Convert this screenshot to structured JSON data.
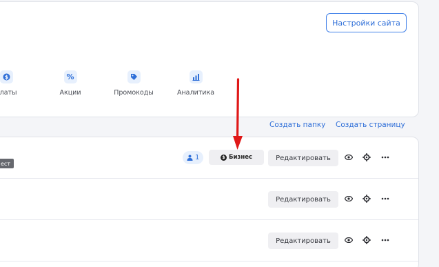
{
  "header": {
    "settings_label": "Настройки сайта"
  },
  "nav": {
    "items": [
      {
        "label": "платы",
        "icon": "dollar-icon",
        "glyph": "$"
      },
      {
        "label": "Акции",
        "icon": "percent-icon",
        "glyph": "%"
      },
      {
        "label": "Промокоды",
        "icon": "tag-icon",
        "glyph": ""
      },
      {
        "label": "Аналитика",
        "icon": "chart-icon",
        "glyph": ""
      }
    ]
  },
  "actions": {
    "create_folder": "Создать папку",
    "create_page": "Создать страницу"
  },
  "rows": [
    {
      "badge": "ест",
      "users_count": "1",
      "plan": "Бизнес",
      "edit_label": "Редактировать"
    },
    {
      "edit_label": "Редактировать"
    },
    {
      "edit_label": "Редактировать"
    }
  ],
  "colors": {
    "accent": "#2f6fd8",
    "arrow": "#e01818"
  }
}
